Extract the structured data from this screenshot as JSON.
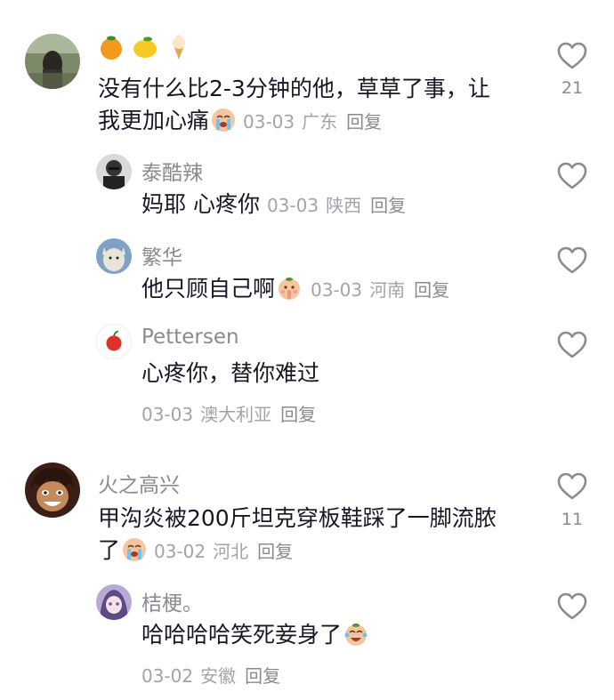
{
  "comments": [
    {
      "name_icons": [
        "orange-emoji",
        "lemon-emoji",
        "ice-cream-emoji"
      ],
      "line1": "没有什么比2-3分钟的他，草草了事，让",
      "line2": "我更加心痛",
      "date": "03-03",
      "location": "广东",
      "reply": "回复",
      "likes": "21",
      "replies": [
        {
          "name": "泰酷辣",
          "text": "妈耶 心疼你",
          "date": "03-03",
          "location": "陕西",
          "reply": "回复"
        },
        {
          "name": "繁华",
          "text": "他只顾自己啊",
          "date": "03-03",
          "location": "河南",
          "reply": "回复"
        },
        {
          "name": "Pettersen",
          "text": "心疼你，替你难过",
          "date": "03-03",
          "location": "澳大利亚",
          "reply": "回复"
        }
      ]
    },
    {
      "name": "火之高兴",
      "line1": "甲沟炎被200斤坦克穿板鞋踩了一脚流脓",
      "line2": "了",
      "date": "03-02",
      "location": "河北",
      "reply": "回复",
      "likes": "11",
      "replies": [
        {
          "name": "桔梗。",
          "text": "哈哈哈哈笑死妾身了",
          "date": "03-02",
          "location": "安徽",
          "reply": "回复"
        }
      ]
    }
  ]
}
